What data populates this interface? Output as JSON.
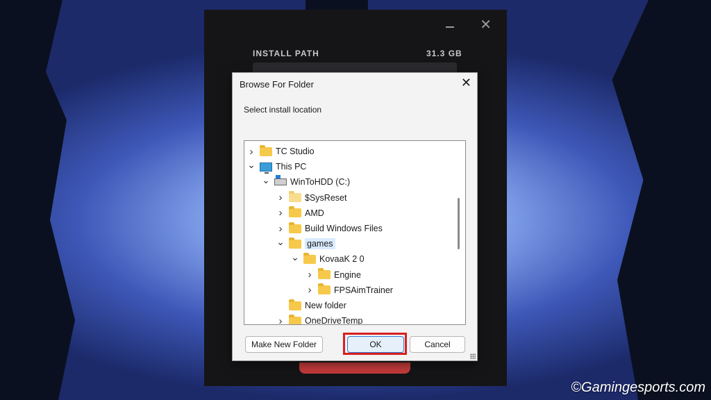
{
  "launcher": {
    "install_path_label": "INSTALL PATH",
    "install_size": "31.3 GB",
    "close_icon": "close-icon",
    "minimize_icon": "minimize-icon"
  },
  "dialog": {
    "title": "Browse For Folder",
    "subtitle": "Select install location",
    "close_icon": "close-icon",
    "tree": [
      {
        "label": "TC Studio",
        "level": 0,
        "expander": "collapsed",
        "icon": "folder-icon",
        "selected": false
      },
      {
        "label": "This PC",
        "level": 0,
        "expander": "expanded",
        "icon": "computer-icon",
        "selected": false
      },
      {
        "label": "WinToHDD (C:)",
        "level": 1,
        "expander": "expanded",
        "icon": "drive-icon",
        "selected": false
      },
      {
        "label": "$SysReset",
        "level": 2,
        "expander": "collapsed",
        "icon": "folder-icon-pale",
        "selected": false
      },
      {
        "label": "AMD",
        "level": 2,
        "expander": "collapsed",
        "icon": "folder-icon",
        "selected": false
      },
      {
        "label": "Build Windows Files",
        "level": 2,
        "expander": "collapsed",
        "icon": "folder-icon",
        "selected": false
      },
      {
        "label": "games",
        "level": 2,
        "expander": "expanded",
        "icon": "folder-icon",
        "selected": true
      },
      {
        "label": "KovaaK 2 0",
        "level": 3,
        "expander": "expanded",
        "icon": "folder-icon",
        "selected": false
      },
      {
        "label": "Engine",
        "level": 4,
        "expander": "collapsed",
        "icon": "folder-icon",
        "selected": false
      },
      {
        "label": "FPSAimTrainer",
        "level": 4,
        "expander": "collapsed",
        "icon": "folder-icon",
        "selected": false
      },
      {
        "label": "New folder",
        "level": 2,
        "expander": "none",
        "icon": "folder-icon",
        "selected": false
      },
      {
        "label": "OneDriveTemp",
        "level": 2,
        "expander": "collapsed",
        "icon": "folder-icon",
        "selected": false
      }
    ],
    "buttons": {
      "make_new_folder": "Make New Folder",
      "ok": "OK",
      "cancel": "Cancel"
    }
  },
  "watermark": "©Gamingesports.com",
  "colors": {
    "highlight_box": "#d9201f",
    "selection": "#d9ebff",
    "folder": "#f6c94a",
    "launcher_bg": "#151517"
  }
}
